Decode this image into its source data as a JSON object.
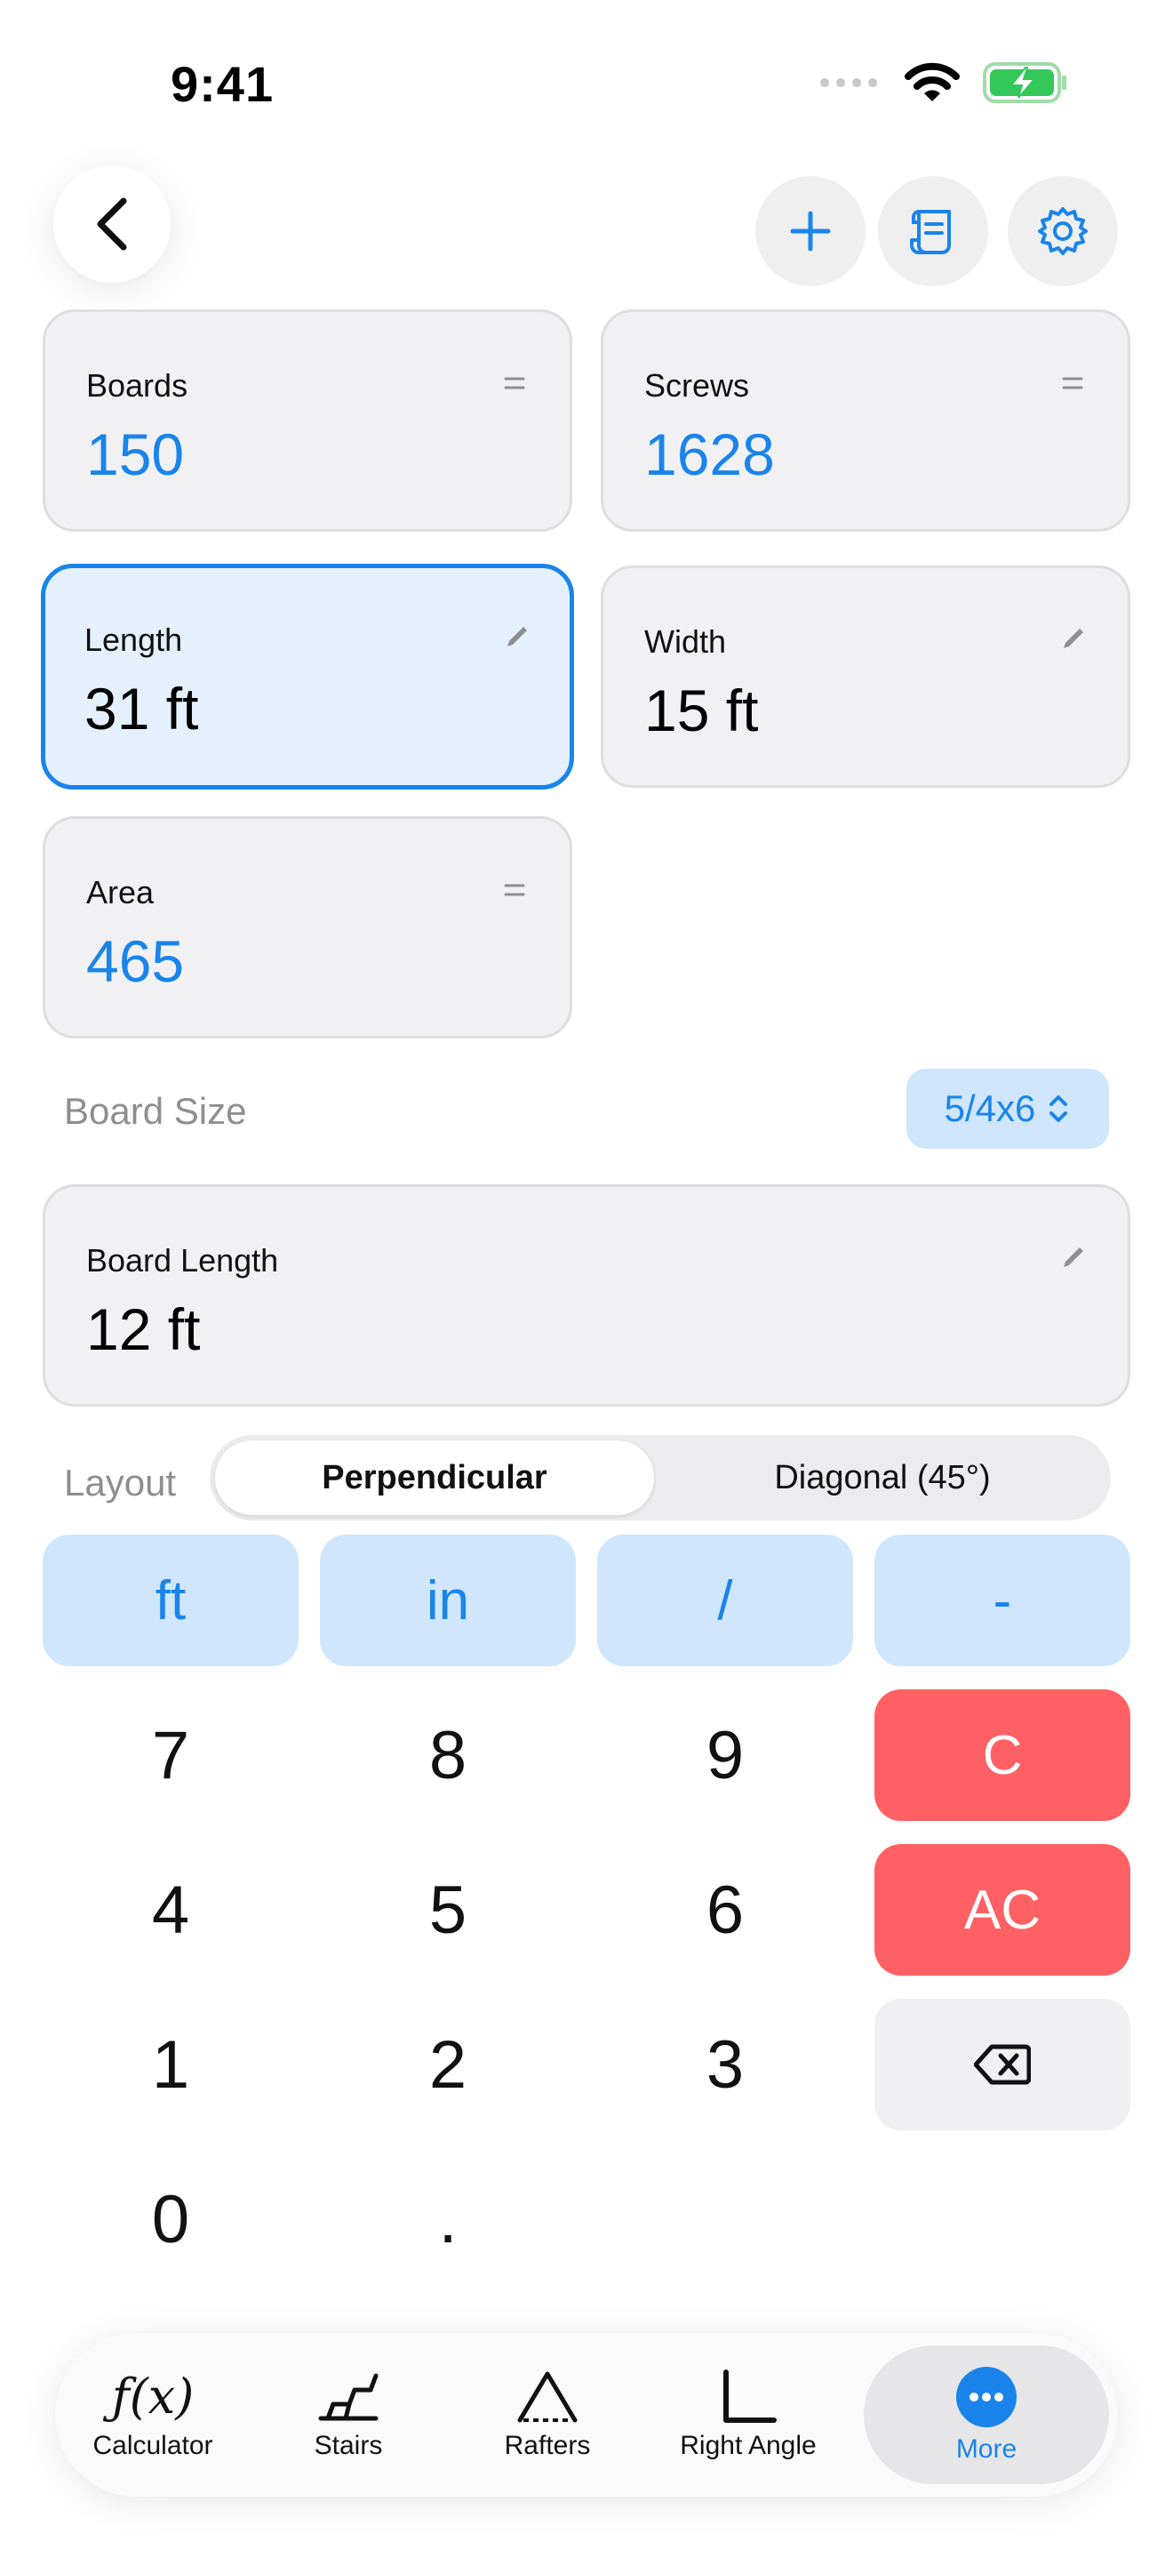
{
  "status": {
    "time": "9:41"
  },
  "cards": {
    "boards": {
      "label": "Boards",
      "value": "150"
    },
    "screws": {
      "label": "Screws",
      "value": "1628"
    },
    "length": {
      "label": "Length",
      "value": "31 ft"
    },
    "width": {
      "label": "Width",
      "value": "15 ft"
    },
    "area": {
      "label": "Area",
      "value": "465"
    },
    "board_length": {
      "label": "Board Length",
      "value": "12 ft"
    }
  },
  "board_size": {
    "label": "Board Size",
    "value": "5/4x6"
  },
  "layout": {
    "label": "Layout",
    "options": [
      "Perpendicular",
      "Diagonal (45°)"
    ],
    "selected": "Perpendicular"
  },
  "keypad": {
    "units": [
      "ft",
      "in",
      "/",
      "-"
    ],
    "digits": [
      "7",
      "8",
      "9",
      "4",
      "5",
      "6",
      "1",
      "2",
      "3",
      "0",
      "."
    ],
    "clear": "C",
    "all_clear": "AC"
  },
  "tabs": [
    {
      "label": "Calculator",
      "icon": "function-icon"
    },
    {
      "label": "Stairs",
      "icon": "stairs-icon"
    },
    {
      "label": "Rafters",
      "icon": "rafters-icon"
    },
    {
      "label": "Right Angle",
      "icon": "right-angle-icon"
    },
    {
      "label": "More",
      "icon": "more-icon"
    }
  ],
  "active_tab": "More",
  "colors": {
    "accent": "#1a84ea",
    "danger": "#ff6064",
    "unit_key": "#cfe6fc",
    "battery": "#34c759"
  }
}
